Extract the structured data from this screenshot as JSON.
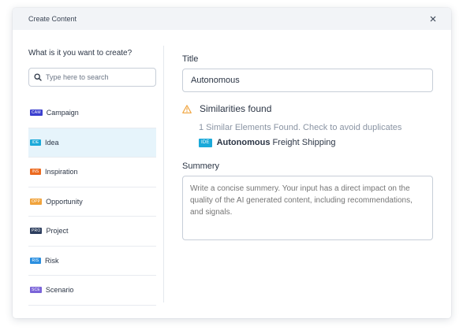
{
  "dialog": {
    "title": "Create Content",
    "close_label": "×"
  },
  "left": {
    "question": "What is it you want to create?",
    "search_placeholder": "Type here to search",
    "items": [
      {
        "badge": "CAM",
        "label": "Campaign",
        "color": "#3b3fcf"
      },
      {
        "badge": "IDE",
        "label": "Idea",
        "color": "#1aa9d9"
      },
      {
        "badge": "INS",
        "label": "Inspiration",
        "color": "#ec6a1f"
      },
      {
        "badge": "OPP",
        "label": "Opportunity",
        "color": "#f0a33c"
      },
      {
        "badge": "PRO",
        "label": "Project",
        "color": "#2d3e5e"
      },
      {
        "badge": "RIS",
        "label": "Risk",
        "color": "#2b8fe0"
      },
      {
        "badge": "SCE",
        "label": "Scenario",
        "color": "#7a63d8"
      }
    ],
    "selected_index": 1
  },
  "right": {
    "title_label": "Title",
    "title_value": "Autonomous",
    "similarities_title": "Similarities found",
    "similarities_sub": "1 Similar Elements Found. Check to avoid duplicates",
    "similar_item": {
      "badge": "IDE",
      "bold": "Autonomous",
      "rest": "Freight Shipping",
      "color": "#1aa9d9"
    },
    "summary_label": "Summery",
    "summary_placeholder": "Write a concise summery. Your input has a direct impact on the quality of the AI generated content, including recommendations, and signals."
  },
  "colors": {
    "warning": "#f0a33c",
    "selected_bg": "#e6f4fb"
  }
}
